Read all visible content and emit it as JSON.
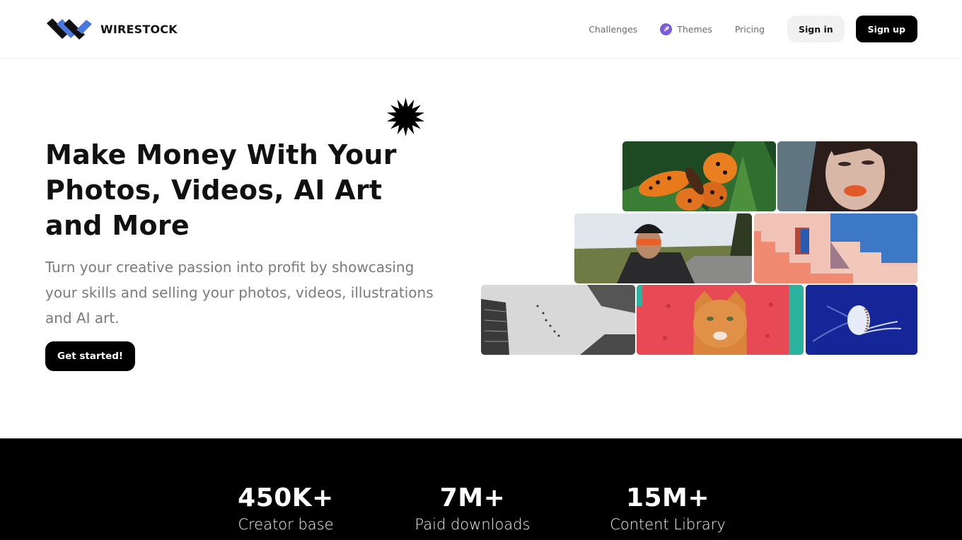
{
  "brand": {
    "name": "WIRESTOCK",
    "colors": {
      "primary_dark": "#111111",
      "accent_blue": "#4a78e0",
      "themes_purple": "#7b5ce0"
    }
  },
  "nav": {
    "links": [
      {
        "label": "Challenges",
        "icon": null
      },
      {
        "label": "Themes",
        "icon": "rocket-icon"
      },
      {
        "label": "Pricing",
        "icon": null
      }
    ],
    "sign_in_label": "Sign in",
    "sign_up_label": "Sign up"
  },
  "hero": {
    "title": "Make Money With Your Photos, Videos, AI Art and More",
    "subtitle": "Turn your creative passion into profit by showcasing your skills and selling your photos, videos, illustrations and AI art.",
    "cta_label": "Get started!",
    "decoration_icon": "starburst-icon"
  },
  "collage": {
    "images": [
      {
        "subject": "orange butterfly on green fern"
      },
      {
        "subject": "portrait of woman with orange lipstick"
      },
      {
        "subject": "cyclist with helmet and sunglasses on road"
      },
      {
        "subject": "pink stepped architecture against blue sky"
      },
      {
        "subject": "black and white buildings with birds looking up"
      },
      {
        "subject": "orange cat on red tufted chair"
      },
      {
        "subject": "jellyfish in deep blue water"
      }
    ]
  },
  "stats": [
    {
      "value": "450K+",
      "label": "Creator base"
    },
    {
      "value": "7M+",
      "label": "Paid downloads"
    },
    {
      "value": "15M+",
      "label": "Content Library"
    }
  ]
}
